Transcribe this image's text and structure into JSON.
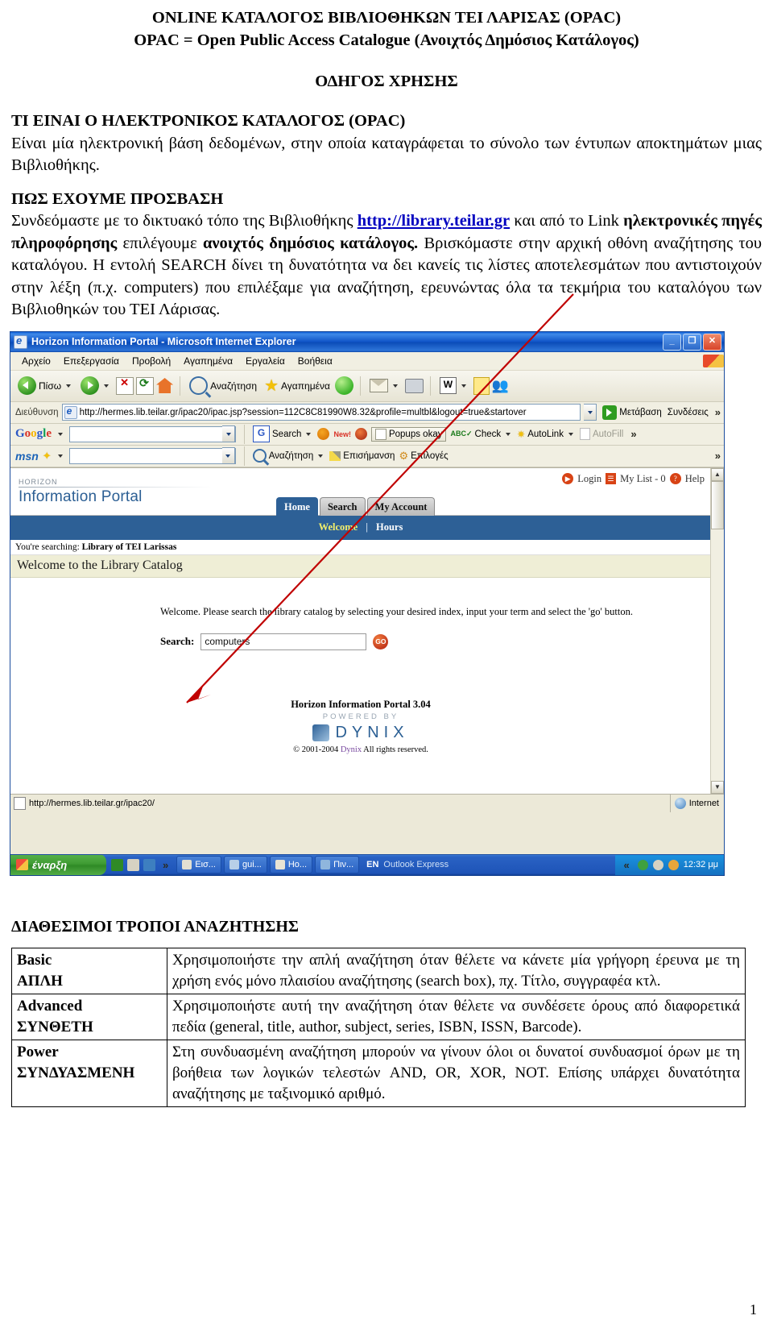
{
  "doc": {
    "title_line1": "ONLINE ΚΑΤΑΛΟΓΟΣ ΒΙΒΛΙΟΘΗΚΩΝ ΤΕΙ ΛΑΡΙΣΑΣ (OPAC)",
    "title_line2": "OPAC = Open Public Access Catalogue (Ανοιχτός Δημόσιος Κατάλογος)",
    "guide_title": "ΟΔΗΓΟΣ ΧΡΗΣΗΣ",
    "section1_heading": "ΤΙ ΕΙΝΑΙ Ο ΗΛΕΚΤΡΟΝΙΚΟΣ ΚΑΤΑΛΟΓΟΣ (OPAC)",
    "section1_body": "Είναι μία ηλεκτρονική βάση δεδομένων, στην οποία καταγράφεται το σύνολο των έντυπων αποκτημάτων μιας Βιβλιοθήκης.",
    "section2_heading": "ΠΩΣ ΕΧΟΥΜΕ ΠΡΟΣΒΑΣΗ",
    "section2_p1_pre": "Συνδεόμαστε  με το δικτυακό τόπο της Βιβλιοθήκης ",
    "section2_link": "http://library.teilar.gr",
    "section2_p1_post": " και από το Link ",
    "section2_b1": "ηλεκτρονικές πηγές πληροφόρησης",
    "section2_mid": " επιλέγουμε ",
    "section2_b2": "ανοιχτός δημόσιος κατάλογος.",
    "section2_p2": " Βρισκόμαστε στην αρχική οθόνη αναζήτησης του καταλόγου. Η εντολή SEARCH δίνει τη δυνατότητα να δει κανείς τις λίστες αποτελεσμάτων που αντιστοιχούν στην λέξη (π.χ. computers) που επιλέξαμε για αναζήτηση, ερευνώντας όλα τα τεκμήρια του καταλόγου των Βιβλιοθηκών του ΤΕΙ Λάρισας.",
    "section3_heading": "ΔΙΑΘΕΣΙΜΟΙ ΤΡΟΠΟΙ ΑΝΑΖΗΤΗΣΗΣ",
    "page_number": "1"
  },
  "browser": {
    "window_title": "Horizon Information Portal - Microsoft Internet Explorer",
    "window_buttons": {
      "minimize": "_",
      "restore": "❐",
      "close": "✕"
    },
    "menu": [
      "Αρχείο",
      "Επεξεργασία",
      "Προβολή",
      "Αγαπημένα",
      "Εργαλεία",
      "Βοήθεια"
    ],
    "toolbar": {
      "back": "Πίσω",
      "search": "Αναζήτηση",
      "favorites": "Αγαπημένα"
    },
    "address": {
      "label": "Διεύθυνση",
      "url": "http://hermes.lib.teilar.gr/ipac20/ipac.jsp?session=112C8C81990W8.32&profile=multbl&logout=true&startover",
      "go": "Μετάβαση",
      "links": "Συνδέσεις",
      "overflow": "»"
    },
    "google_toolbar": {
      "brand": "Google",
      "query": "",
      "search": "Search",
      "new_badge": "New!",
      "popups": "Popups okay",
      "check": "Check",
      "autolink": "AutoLink",
      "autofill": "AutoFill",
      "overflow": "»"
    },
    "msn_toolbar": {
      "brand": "msn",
      "query": "",
      "search": "Αναζήτηση",
      "highlight": "Επισήμανση",
      "options": "Επιλογές",
      "overflow": "»"
    },
    "status": {
      "url": "http://hermes.lib.teilar.gr/ipac20/",
      "zone": "Internet"
    }
  },
  "portal": {
    "brand_small": "HORIZON",
    "brand_big": "Information Portal",
    "top_links": [
      {
        "label": "Login",
        "icon": "play-icon"
      },
      {
        "label": "My List - 0",
        "icon": "list-icon"
      },
      {
        "label": "Help",
        "icon": "question-icon"
      }
    ],
    "tabs": [
      {
        "label": "Home",
        "active": true
      },
      {
        "label": "Search",
        "active": false
      },
      {
        "label": "My Account",
        "active": false
      }
    ],
    "subnav": {
      "active": "Welcome",
      "other": "Hours",
      "separator": "|"
    },
    "searching_prefix": "You're searching:",
    "searching_library": "Library of TEI Larissas",
    "welcome_heading": "Welcome to the Library Catalog",
    "welcome_text": "Welcome. Please search the library catalog by selecting your desired index, input your term and select the 'go' button.",
    "search_label": "Search:",
    "search_value": "computers",
    "go_button": "GO",
    "footer_product": "Horizon Information Portal 3.04",
    "footer_powered": "POWERED BY",
    "footer_brand": "DYNIX",
    "footer_copy_pre": "© 2001-2004 ",
    "footer_copy_brand": "Dynix",
    "footer_copy_post": " All rights reserved."
  },
  "taskbar": {
    "start": "έναρξη",
    "items": [
      "Εισ...",
      "gui...",
      "Ho...",
      "Πιν..."
    ],
    "language": "EN",
    "outlook": "Outlook Express",
    "clock": "12:32 μμ"
  },
  "modes_table": {
    "rows": [
      {
        "key_en": "Basic",
        "key_gr": "ΑΠΛΗ",
        "desc": "Χρησιμοποιήστε την απλή αναζήτηση όταν θέλετε να κάνετε μία γρήγορη έρευνα με τη χρήση ενός μόνο πλαισίου αναζήτησης (search box), πχ. Τίτλο, συγγραφέα κτλ."
      },
      {
        "key_en": "Advanced",
        "key_gr": "ΣΥΝΘΕΤΗ",
        "desc": "Χρησιμοποιήστε αυτή την αναζήτηση όταν θέλετε να συνδέσετε όρους από διαφορετικά πεδία (general, title, author, subject, series, ISBN, ISSN, Barcode)."
      },
      {
        "key_en": "Power",
        "key_gr": "ΣΥΝΔΥΑΣΜΕΝΗ",
        "desc": "Στη συνδυασμένη αναζήτηση μπορούν να γίνουν όλοι οι δυνατοί συνδυασμοί όρων με τη βοήθεια των λογικών τελεστών AND, OR, XOR, NOT. Επίσης υπάρχει δυνατότητα αναζήτησης με ταξινομικό αριθμό."
      }
    ]
  },
  "colors": {
    "link": "#0000c0",
    "annotation_arrow": "#c00000",
    "portal_blue": "#2d6096",
    "title_blue": "#1155c8"
  }
}
